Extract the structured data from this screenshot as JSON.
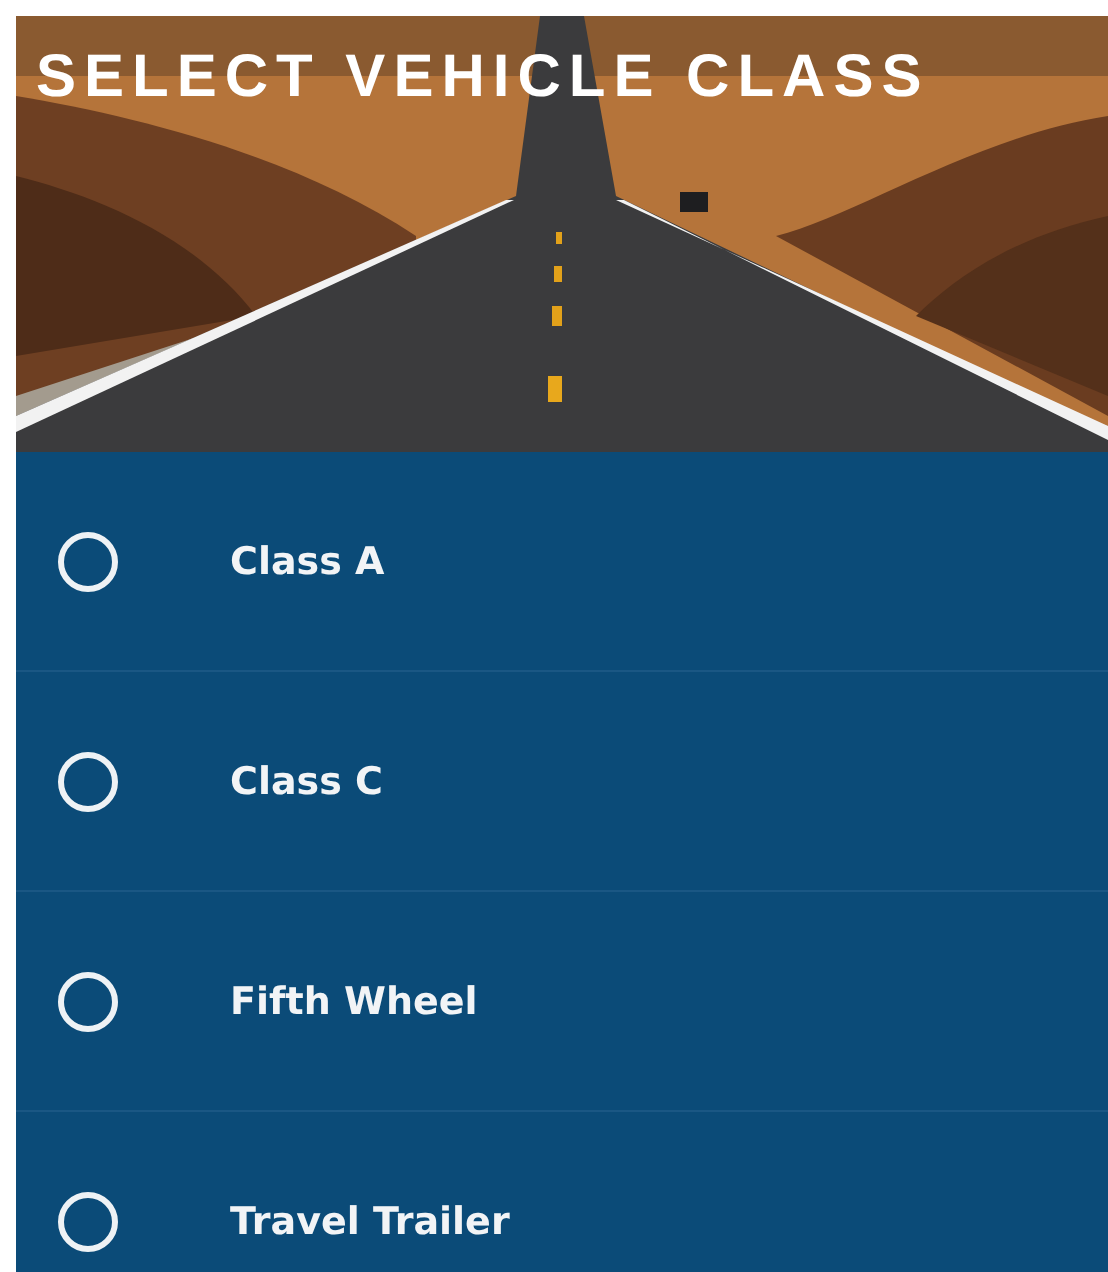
{
  "header": {
    "title": "SELECT VEHICLE CLASS",
    "kind": "picture"
  },
  "options": [
    {
      "label": "Class A",
      "selected": false
    },
    {
      "label": "Class C",
      "selected": false
    },
    {
      "label": "Fifth Wheel",
      "selected": false
    },
    {
      "label": "Travel Trailer",
      "selected": false
    }
  ]
}
